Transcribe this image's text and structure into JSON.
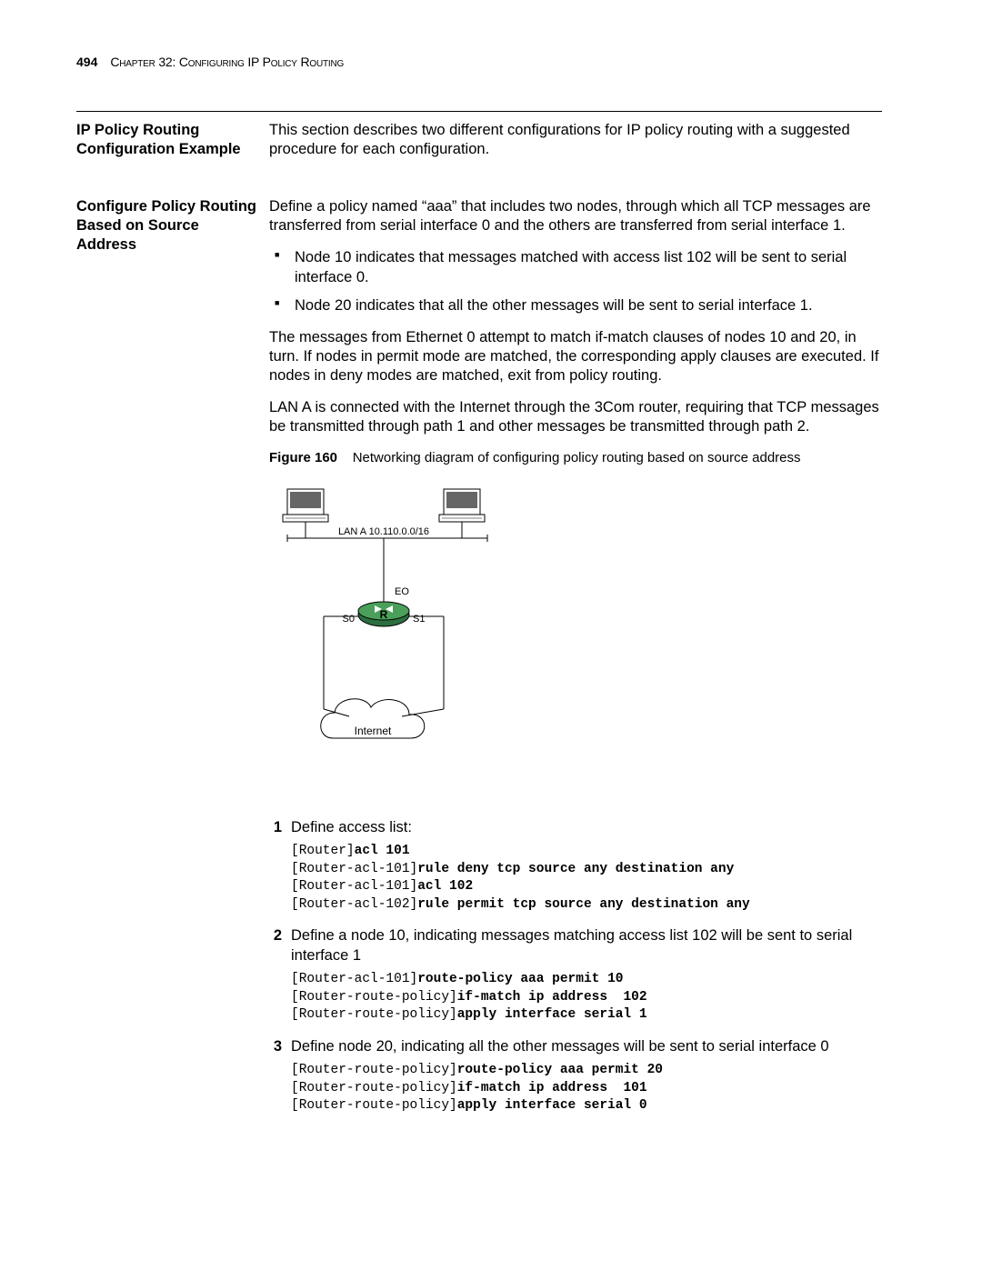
{
  "header": {
    "page_number": "494",
    "chapter": "Chapter 32: Configuring IP Policy Routing"
  },
  "section": {
    "heading": "IP Policy Routing Configuration Example",
    "intro": "This section describes two different configurations for IP policy routing with a suggested procedure for each configuration."
  },
  "subsection": {
    "heading": "Configure Policy Routing Based on Source Address",
    "para1": "Define a policy named “aaa” that includes two nodes, through which all TCP messages are transferred from serial interface 0 and the others are transferred from serial interface 1.",
    "bullet1": "Node 10 indicates that messages matched with access list 102 will be sent to serial interface 0.",
    "bullet2": "Node 20 indicates that all the other messages will be sent to serial interface 1.",
    "para2": "The messages from Ethernet 0 attempt to match if-match clauses of nodes 10 and 20, in turn. If nodes in permit mode are matched, the corresponding apply clauses are executed. If nodes in deny modes are matched, exit from policy routing.",
    "para3": "LAN A is connected with the Internet through the 3Com router, requiring that TCP messages be transmitted through path 1 and other messages be transmitted through path 2."
  },
  "figure": {
    "label": "Figure 160",
    "caption": "Networking diagram of configuring policy routing based on source address",
    "lan_label": "LAN A 10.110.0.0/16",
    "e0": "EO",
    "s0": "S0",
    "s1": "S1",
    "router_r": "R",
    "internet": "Internet"
  },
  "steps": {
    "s1_num": "1",
    "s1_text": "Define access list:",
    "s1_code_l1_a": "[Router]",
    "s1_code_l1_b": "acl 101",
    "s1_code_l2_a": "[Router-acl-101]",
    "s1_code_l2_b": "rule deny tcp source any destination any",
    "s1_code_l3_a": "[Router-acl-101]",
    "s1_code_l3_b": "acl 102",
    "s1_code_l4_a": "[Router-acl-102]",
    "s1_code_l4_b": "rule permit tcp source any destination any",
    "s2_num": "2",
    "s2_text": "Define a node 10, indicating messages matching access list 102 will be sent to serial interface 1",
    "s2_code_l1_a": "[Router-acl-101]",
    "s2_code_l1_b": "route-policy aaa permit 10",
    "s2_code_l2_a": "[Router-route-policy]",
    "s2_code_l2_b": "if-match ip address  102",
    "s2_code_l3_a": "[Router-route-policy]",
    "s2_code_l3_b": "apply interface serial 1",
    "s3_num": "3",
    "s3_text": "Define node 20, indicating all the other messages will be sent to serial interface 0",
    "s3_code_l1_a": "[Router-route-policy]",
    "s3_code_l1_b": "route-policy aaa permit 20",
    "s3_code_l2_a": "[Router-route-policy]",
    "s3_code_l2_b": "if-match ip address  101",
    "s3_code_l3_a": "[Router-route-policy]",
    "s3_code_l3_b": "apply interface serial 0"
  }
}
